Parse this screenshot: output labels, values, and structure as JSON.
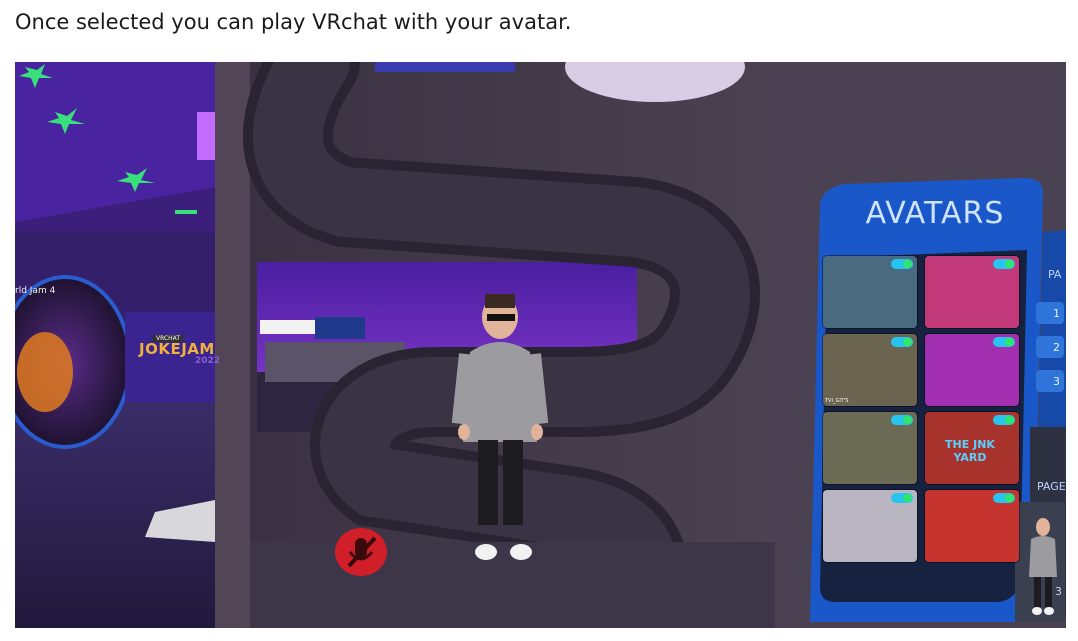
{
  "caption": "Once selected you can play VRchat with your avatar.",
  "scene": {
    "world_sign_text": "rld Jam 4",
    "vrchat_badge": "VRCHAT",
    "joke_jam_logo": "JOKEJAM",
    "joke_jam_year": "2022",
    "mute_icon": "muted-microphone-icon"
  },
  "avatars_panel": {
    "title": "AVATARS",
    "side_top_label": "PA",
    "side_bottom_label": "PAGE",
    "page_buttons": [
      "1",
      "2",
      "3"
    ],
    "preview_number": "3",
    "tiles": [
      {
        "name": "avatar-tile-1",
        "bg": "#4a6a80"
      },
      {
        "name": "avatar-tile-2",
        "bg": "#c23a7a"
      },
      {
        "name": "avatar-tile-3",
        "bg": "#6b6450"
      },
      {
        "name": "avatar-tile-4",
        "bg": "#a12fb0"
      },
      {
        "name": "avatar-tile-5",
        "bg": "#6a6a55"
      },
      {
        "name": "avatar-tile-6",
        "bg": "#a8322c"
      },
      {
        "name": "avatar-tile-7",
        "bg": "#b9b6c2"
      },
      {
        "name": "avatar-tile-8",
        "bg": "#c5342e"
      }
    ],
    "tile_text_3": "TVI_GIT'S",
    "tile_text_6": "THE JNK YARD"
  },
  "colors": {
    "panel_blue": "#1a58c9",
    "panel_dark": "#172240",
    "accent_purple": "#6a2bd0"
  }
}
